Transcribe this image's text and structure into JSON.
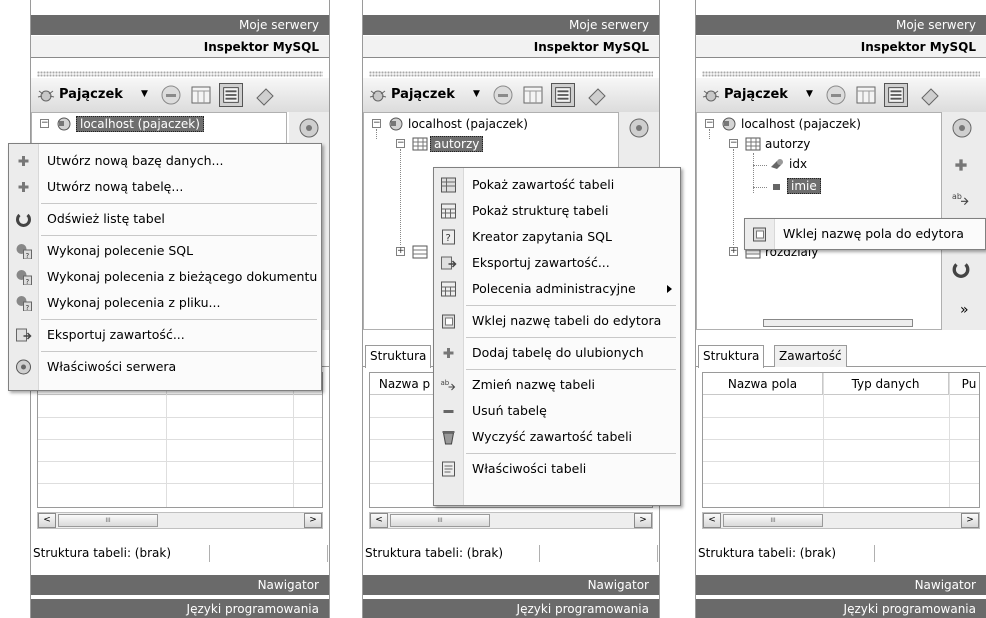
{
  "common": {
    "top_header": "Moje serwery",
    "inspector_title": "Inspektor MySQL",
    "toolbar_label": "Pajączek",
    "dropdown_arrow": "▼",
    "server_node": "localhost (pajaczek)",
    "status_text": "Struktura tabeli: (brak)",
    "nav_header": "Nawigator",
    "lang_header": "Języki programowania",
    "tab_structure": "Struktura",
    "tab_content": "Zawartość",
    "col_name": "Nazwa pola",
    "col_name_cut": "Nazwa p",
    "col_type": "Typ danych",
    "col_null_cut": "Pu",
    "scroll_left": "<",
    "scroll_right": ">",
    "thumb_grip": "III",
    "more_glyph": "»",
    "colors": {
      "header_bg": "#6a6a6a",
      "selection_bg": "#6e6e6e",
      "menu_gutter": "#ececec"
    }
  },
  "panel1": {
    "menu": [
      {
        "icon": "plus-icon",
        "label": "Utwórz nową bazę danych..."
      },
      {
        "icon": "plus-icon",
        "label": "Utwórz nową tabelę..."
      },
      {
        "icon": "refresh-icon",
        "label": "Odśwież listę tabel"
      },
      {
        "icon": "sql-query-icon",
        "label": "Wykonaj polecenie SQL"
      },
      {
        "icon": "sql-query-icon",
        "label": "Wykonaj polecenia z bieżącego dokumentu"
      },
      {
        "icon": "sql-query-icon",
        "label": "Wykonaj polecenia z pliku..."
      },
      {
        "icon": "export-icon",
        "label": "Eksportuj zawartość..."
      },
      {
        "icon": "server-properties-icon",
        "label": "Właściwości serwera"
      }
    ]
  },
  "panel2": {
    "table_node": "autorzy",
    "menu": [
      {
        "icon": "table-content-icon",
        "label": "Pokaż zawartość tabeli"
      },
      {
        "icon": "table-structure-icon",
        "label": "Pokaż strukturę tabeli"
      },
      {
        "icon": "query-wizard-icon",
        "label": "Kreator zapytania SQL"
      },
      {
        "icon": "export-icon",
        "label": "Eksportuj zawartość..."
      },
      {
        "icon": "admin-commands-icon",
        "label": "Polecenia administracyjne"
      },
      {
        "icon": "paste-name-icon",
        "label": "Wklej nazwę tabeli do edytora"
      },
      {
        "icon": "add-favorite-icon",
        "label": "Dodaj tabelę do ulubionych"
      },
      {
        "icon": "rename-icon",
        "label": "Zmień nazwę tabeli"
      },
      {
        "icon": "delete-table-icon",
        "label": "Usuń tabelę"
      },
      {
        "icon": "clear-table-icon",
        "label": "Wyczyść zawartość tabeli"
      },
      {
        "icon": "table-properties-icon",
        "label": "Właściwości tabeli"
      }
    ]
  },
  "panel3": {
    "table_node": "autorzy",
    "field_idx": "idx",
    "field_imie": "imie",
    "table_node_2": "rozdzialy",
    "menu": [
      {
        "icon": "paste-name-icon",
        "label": "Wklej nazwę pola do edytora"
      }
    ]
  }
}
